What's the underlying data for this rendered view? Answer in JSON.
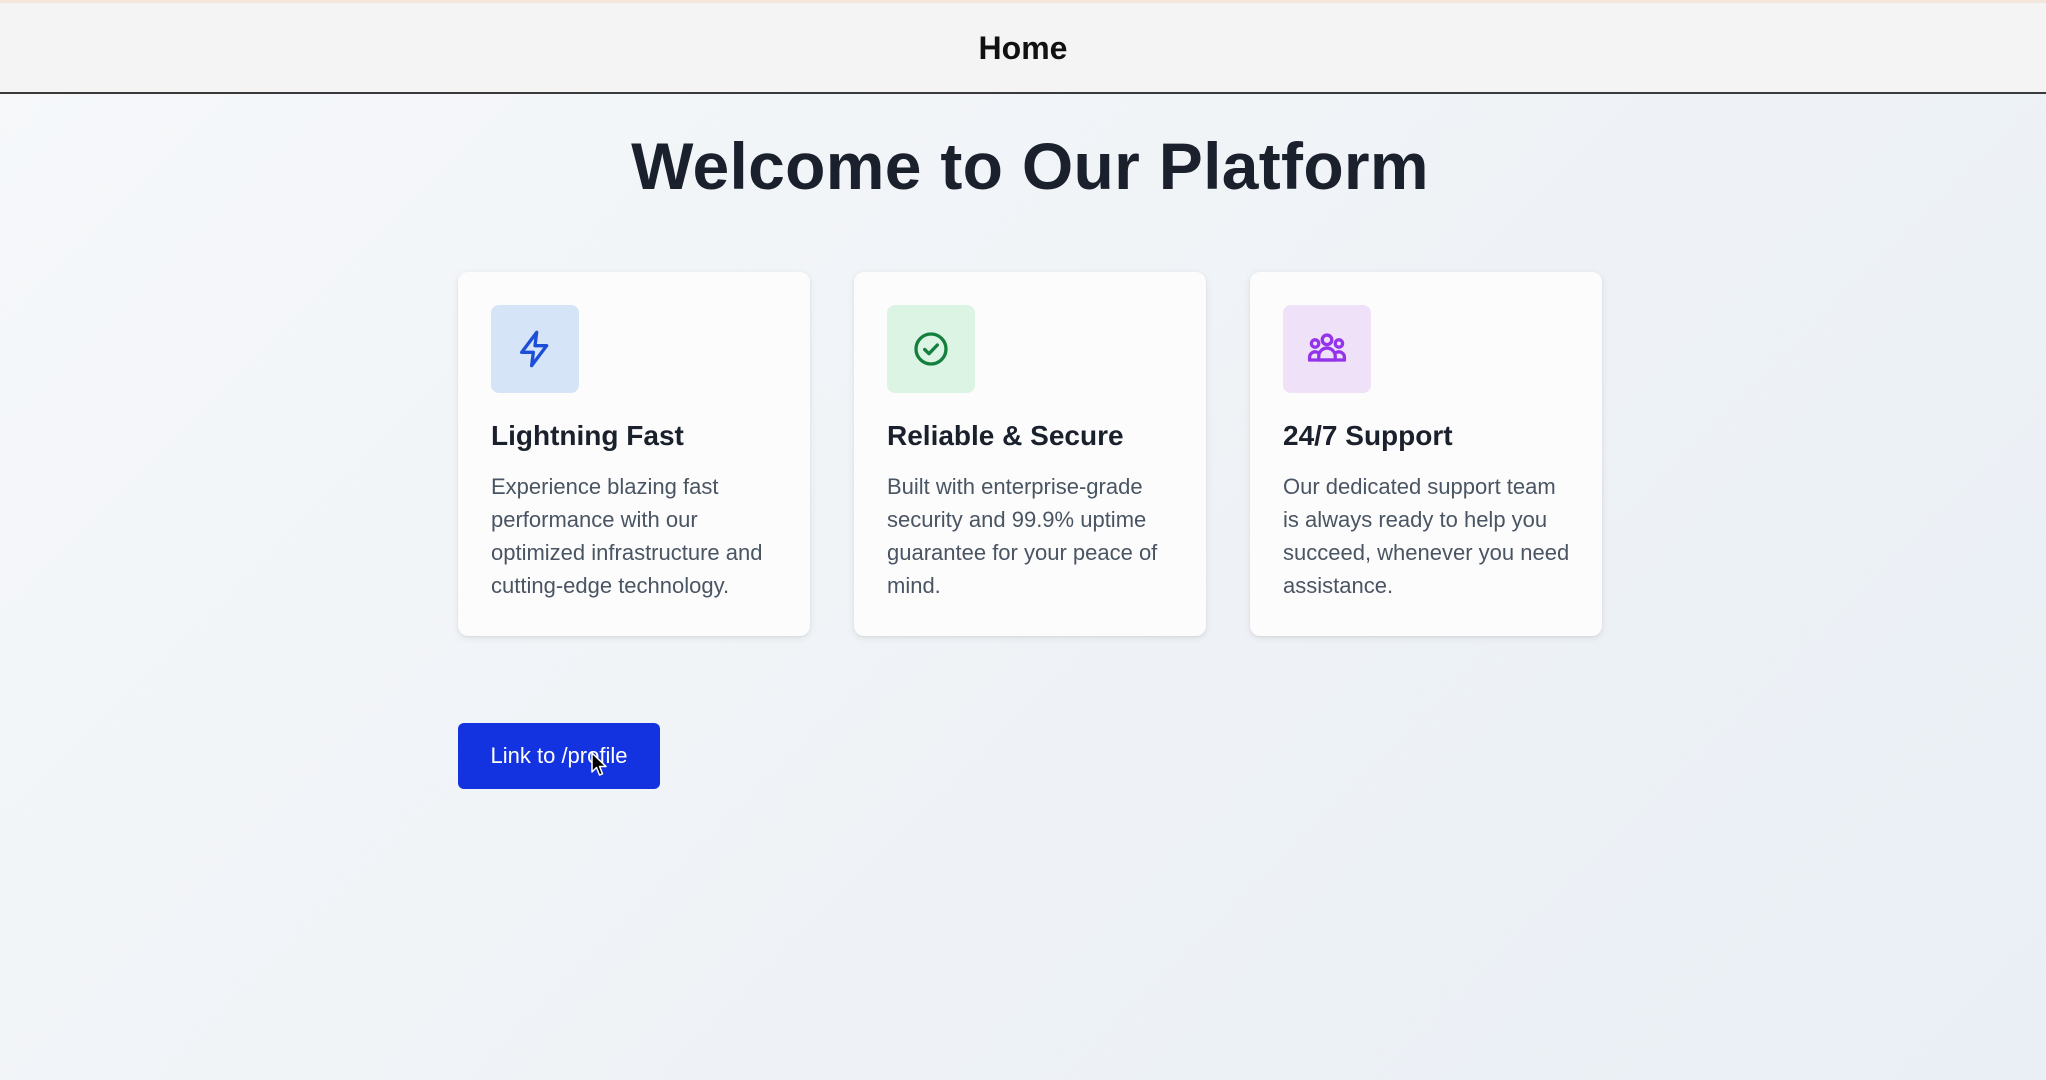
{
  "header": {
    "title": "Home"
  },
  "hero": {
    "heading": "Welcome to Our Platform"
  },
  "features": [
    {
      "icon": "lightning-bolt-icon",
      "icon_color": "#1d4ed8",
      "icon_bg": "#d6e4f7",
      "title": "Lightning Fast",
      "description": "Experience blazing fast performance with our optimized infrastructure and cutting-edge technology."
    },
    {
      "icon": "check-circle-icon",
      "icon_color": "#15803d",
      "icon_bg": "#dcf4e3",
      "title": "Reliable & Secure",
      "description": "Built with enterprise-grade security and 99.9% uptime guarantee for your peace of mind."
    },
    {
      "icon": "users-group-icon",
      "icon_color": "#9333ea",
      "icon_bg": "#efe1f7",
      "title": "24/7 Support",
      "description": "Our dedicated support team is always ready to help you succeed, whenever you need assistance."
    }
  ],
  "cta": {
    "label": "Link to /profile",
    "color": "#1433e0"
  }
}
